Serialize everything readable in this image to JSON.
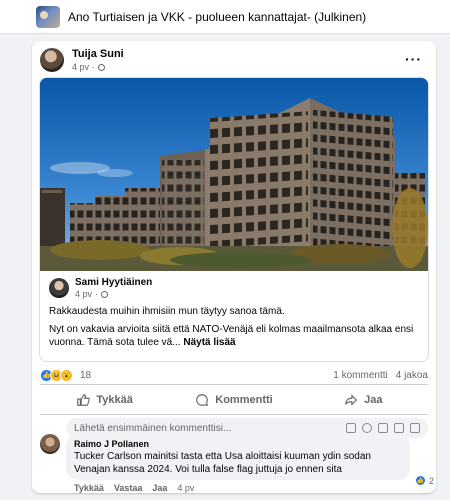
{
  "header": {
    "group_title": "Ano Turtiaisen ja VKK - puolueen kannattajat- (Julkinen)"
  },
  "post": {
    "author": "Tuija Suni",
    "time": "4 pv",
    "more_label": "···",
    "shared": {
      "author": "Sami Hyytiäinen",
      "time": "4 pv",
      "text_1": "Rakkaudesta muihin ihmisiin mun täytyy sanoa tämä.",
      "text_2": "Nyt on vakavia arvioita siitä että NATO-Venäjä eli kolmas maailmansota alkaa ensi vuonna. Tämä sota tulee vä...",
      "see_more": "Näytä lisää"
    },
    "reactions": {
      "count": "18",
      "comments": "1 kommentti",
      "shares": "4 jakoa"
    },
    "actions": {
      "like": "Tykkää",
      "comment": "Kommentti",
      "share": "Jaa"
    },
    "composer": {
      "placeholder": "Lähetä ensimmäinen kommenttisi..."
    },
    "comment": {
      "author": "Raimo J Pollanen",
      "text": "Tucker Carlson mainitsi tasta etta Usa aloittaisi kuuman ydin sodan Venajan kanssa 2024. Voi tulla false flag juttuja jo ennen sita",
      "reaction_count": "2",
      "like": "Tykkää",
      "reply": "Vastaa",
      "share": "Jaa",
      "time": "4 pv"
    }
  },
  "colors": {
    "accent": "#1877f2",
    "background": "#f0f2f5",
    "muted_text": "#65676b"
  }
}
